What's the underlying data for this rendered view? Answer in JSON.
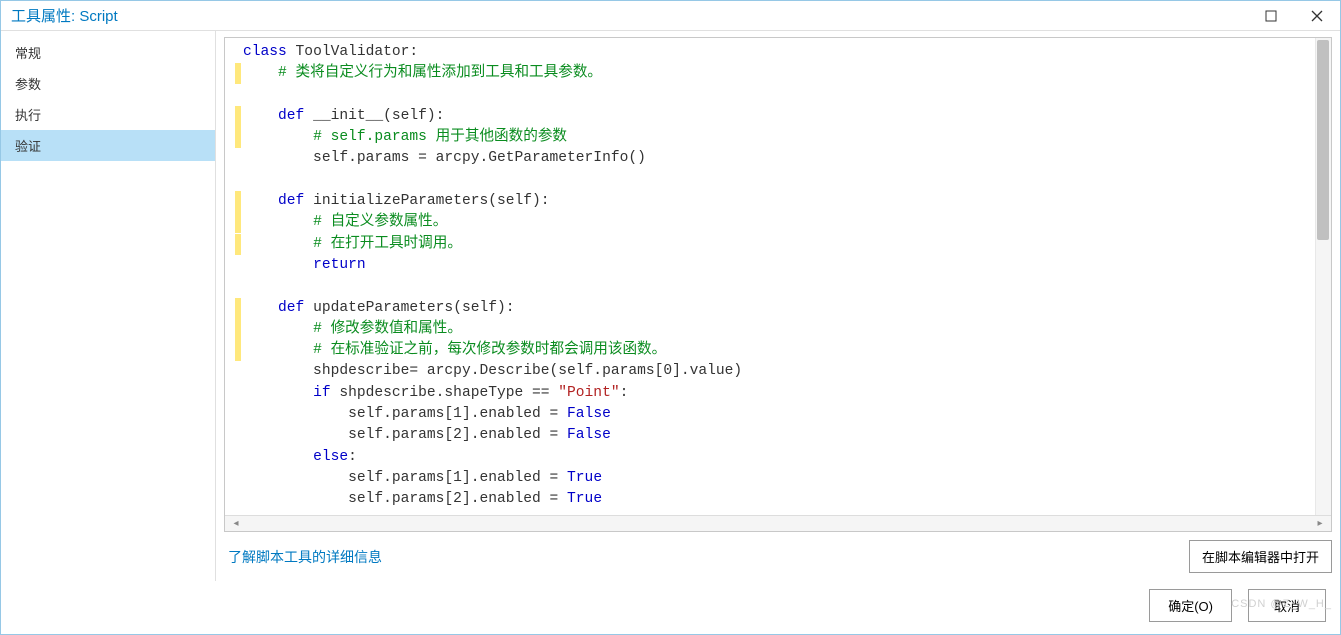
{
  "title": "工具属性: Script",
  "sidebar": {
    "items": [
      {
        "label": "常规"
      },
      {
        "label": "参数"
      },
      {
        "label": "执行"
      },
      {
        "label": "验证"
      }
    ],
    "active_index": 3
  },
  "code": {
    "tokens": [
      [
        [
          "k",
          "class"
        ],
        [
          "n",
          " ToolValidator:"
        ]
      ],
      [
        [
          "hl",
          ""
        ],
        [
          "n",
          "    "
        ],
        [
          "c",
          "# 类将自定义行为和属性添加到工具和工具参数。"
        ]
      ],
      [
        [
          "n",
          " "
        ]
      ],
      [
        [
          "hl",
          ""
        ],
        [
          "n",
          "    "
        ],
        [
          "k",
          "def"
        ],
        [
          "n",
          " __init__(self):"
        ]
      ],
      [
        [
          "hl",
          ""
        ],
        [
          "n",
          "        "
        ],
        [
          "c",
          "# self.params 用于其他函数的参数"
        ]
      ],
      [
        [
          "n",
          "        self.params = arcpy.GetParameterInfo()"
        ]
      ],
      [
        [
          "n",
          " "
        ]
      ],
      [
        [
          "hl",
          ""
        ],
        [
          "n",
          "    "
        ],
        [
          "k",
          "def"
        ],
        [
          "n",
          " initializeParameters(self):"
        ]
      ],
      [
        [
          "hl",
          ""
        ],
        [
          "n",
          "        "
        ],
        [
          "c",
          "# 自定义参数属性。"
        ]
      ],
      [
        [
          "hl",
          ""
        ],
        [
          "n",
          "        "
        ],
        [
          "c",
          "# 在打开工具时调用。"
        ]
      ],
      [
        [
          "n",
          "        "
        ],
        [
          "k",
          "return"
        ]
      ],
      [
        [
          "n",
          " "
        ]
      ],
      [
        [
          "hl",
          ""
        ],
        [
          "n",
          "    "
        ],
        [
          "k",
          "def"
        ],
        [
          "n",
          " updateParameters(self):"
        ]
      ],
      [
        [
          "hl",
          ""
        ],
        [
          "n",
          "        "
        ],
        [
          "c",
          "# 修改参数值和属性。"
        ]
      ],
      [
        [
          "hl",
          ""
        ],
        [
          "n",
          "        "
        ],
        [
          "c",
          "# 在标准验证之前，每次修改参数时都会调用该函数。"
        ]
      ],
      [
        [
          "n",
          "        shpdescribe= arcpy.Describe(self.params[0].value)"
        ]
      ],
      [
        [
          "n",
          "        "
        ],
        [
          "k",
          "if"
        ],
        [
          "n",
          " shpdescribe.shapeType == "
        ],
        [
          "s",
          "\"Point\""
        ],
        [
          "n",
          ":"
        ]
      ],
      [
        [
          "n",
          "            self.params[1].enabled = "
        ],
        [
          "k",
          "False"
        ]
      ],
      [
        [
          "n",
          "            self.params[2].enabled = "
        ],
        [
          "k",
          "False"
        ]
      ],
      [
        [
          "n",
          "        "
        ],
        [
          "k",
          "else"
        ],
        [
          "n",
          ":"
        ]
      ],
      [
        [
          "n",
          "            self.params[1].enabled = "
        ],
        [
          "k",
          "True"
        ]
      ],
      [
        [
          "n",
          "            self.params[2].enabled = "
        ],
        [
          "k",
          "True"
        ]
      ]
    ]
  },
  "bottom": {
    "link": "了解脚本工具的详细信息",
    "open_editor": "在脚本编辑器中打开"
  },
  "footer": {
    "ok": "确定(O)",
    "cancel": "取消"
  },
  "watermark": "CSDN @Z_W_H_"
}
